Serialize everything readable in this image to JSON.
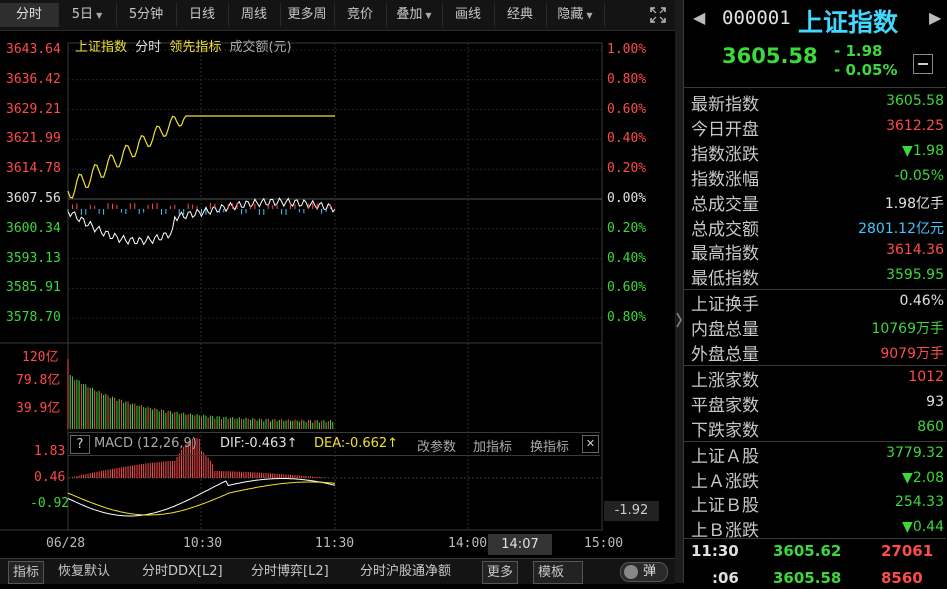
{
  "toolbar": {
    "tabs": [
      {
        "label": "分时",
        "active": true,
        "caret": false
      },
      {
        "label": "5日",
        "active": false,
        "caret": true
      },
      {
        "label": "5分钟",
        "active": false,
        "caret": false
      },
      {
        "label": "日线",
        "active": false,
        "caret": false
      },
      {
        "label": "周线",
        "active": false,
        "caret": false
      },
      {
        "label": "更多周",
        "active": false,
        "caret": false
      },
      {
        "label": "竞价",
        "active": false,
        "caret": false
      },
      {
        "label": "叠加",
        "active": false,
        "caret": true
      },
      {
        "label": "画线",
        "active": false,
        "caret": false
      },
      {
        "label": "经典",
        "active": false,
        "caret": false
      },
      {
        "label": "隐藏",
        "active": false,
        "caret": true
      }
    ],
    "expand_icon": "fullscreen-icon"
  },
  "legend": {
    "index_name": "上证指数",
    "mode": "分时",
    "leading": "领先指标",
    "turnover": "成交额(元)"
  },
  "price_axis": {
    "left": [
      "3643.64",
      "3636.42",
      "3629.21",
      "3621.99",
      "3614.78",
      "3607.56",
      "3600.34",
      "3593.13",
      "3585.91",
      "3578.70"
    ],
    "right": [
      "1.00%",
      "0.80%",
      "0.60%",
      "0.40%",
      "0.20%",
      "0.00%",
      "0.20%",
      "0.40%",
      "0.60%",
      "0.80%"
    ]
  },
  "volume_axis": [
    "120亿",
    "79.8亿",
    "39.9亿"
  ],
  "macd": {
    "help": "?",
    "title": "MACD (12,26,9)",
    "dif": "DIF:-0.463↑",
    "dea": "DEA:-0.662↑",
    "edit_params": "改参数",
    "add_indicator": "加指标",
    "switch_indicator": "换指标",
    "close": "✕",
    "axis": [
      "1.83",
      "0.46",
      "-0.92"
    ],
    "cursor_value": "-1.92"
  },
  "time_axis": {
    "labels": [
      "06/28",
      "10:30",
      "11:30",
      "14:00",
      "15:00"
    ],
    "cursor_time": "14:07"
  },
  "bottombar": {
    "items": [
      "指标",
      "恢复默认",
      "分时DDX[L2]",
      "分时博弈[L2]",
      "分时沪股通净额",
      "更多",
      "模板"
    ],
    "toggle_label": "弹"
  },
  "quote": {
    "code": "000001",
    "name": "上证指数",
    "price": "3605.58",
    "change": "- 1.98",
    "change_pct": "- 0.05%",
    "collapse_icon": "minus-box-icon"
  },
  "stats": [
    {
      "label": "最新指数",
      "value": "3605.58",
      "color": "green"
    },
    {
      "label": "今日开盘",
      "value": "3612.25",
      "color": "red"
    },
    {
      "label": "指数涨跌",
      "value": "▼1.98",
      "color": "green"
    },
    {
      "label": "指数涨幅",
      "value": "-0.05%",
      "color": "green"
    },
    {
      "label": "总成交量",
      "value": "1.98亿手",
      "color": "white"
    },
    {
      "label": "总成交额",
      "value": "2801.12亿元",
      "color": "cyan"
    },
    {
      "label": "最高指数",
      "value": "3614.36",
      "color": "red"
    },
    {
      "label": "最低指数",
      "value": "3595.95",
      "color": "green"
    },
    {
      "label": "上证换手",
      "value": "0.46%",
      "color": "white"
    },
    {
      "label": "内盘总量",
      "value": "10769万手",
      "color": "green"
    },
    {
      "label": "外盘总量",
      "value": "9079万手",
      "color": "red"
    },
    {
      "label": "上涨家数",
      "value": "1012",
      "color": "red"
    },
    {
      "label": "平盘家数",
      "value": "93",
      "color": "white"
    },
    {
      "label": "下跌家数",
      "value": "860",
      "color": "green"
    },
    {
      "label": "上证Ａ股",
      "value": "3779.32",
      "color": "green"
    },
    {
      "label": "上Ａ涨跌",
      "value": "▼2.08",
      "color": "green"
    },
    {
      "label": "上证Ｂ股",
      "value": "254.33",
      "color": "green"
    },
    {
      "label": "上Ｂ涨跌",
      "value": "▼0.44",
      "color": "green"
    }
  ],
  "ticks": [
    {
      "time": "11:30",
      "price": "3605.62",
      "volume": "27061"
    },
    {
      "time": ":06",
      "price": "3605.58",
      "volume": "8560"
    }
  ],
  "colors": {
    "up": "#ff4b4b",
    "down": "#3cd83c",
    "price_line": "#f0e030",
    "avg_line": "#ffffff",
    "cyan": "#40c8ff",
    "macd_dea": "#f0e030",
    "macd_dif": "#ffffff"
  }
}
